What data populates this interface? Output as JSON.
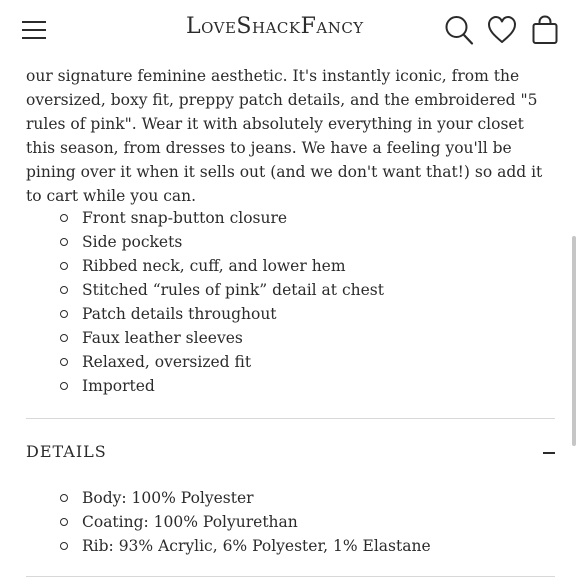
{
  "header": {
    "brand": "LoveShackFancy",
    "icons": [
      "menu-icon",
      "search-icon",
      "heart-icon",
      "bag-icon"
    ]
  },
  "description": "our signature feminine aesthetic. It's instantly iconic, from the oversized, boxy fit, preppy patch details, and the embroidered \"5 rules of pink\". Wear it with absolutely everything in your closet this season, from dresses to jeans. We have a feeling you'll be pining over it when it sells out (and we don't want that!) so add it to cart while you can.",
  "features": [
    "Front snap-button closure",
    "Side pockets",
    "Ribbed neck, cuff, and lower hem",
    "Stitched “rules of pink” detail at chest",
    "Patch details throughout",
    "Faux leather sleeves",
    "Relaxed, oversized fit",
    "Imported"
  ],
  "details": {
    "title": "DETAILS",
    "items": [
      "Body: 100% Polyester",
      "Coating: 100% Polyurethan",
      "Rib: 93% Acrylic, 6% Polyester, 1% Elastane"
    ]
  },
  "colors": {
    "text": "#2b2b2b",
    "divider": "#d8d8d8",
    "background": "#ffffff"
  }
}
